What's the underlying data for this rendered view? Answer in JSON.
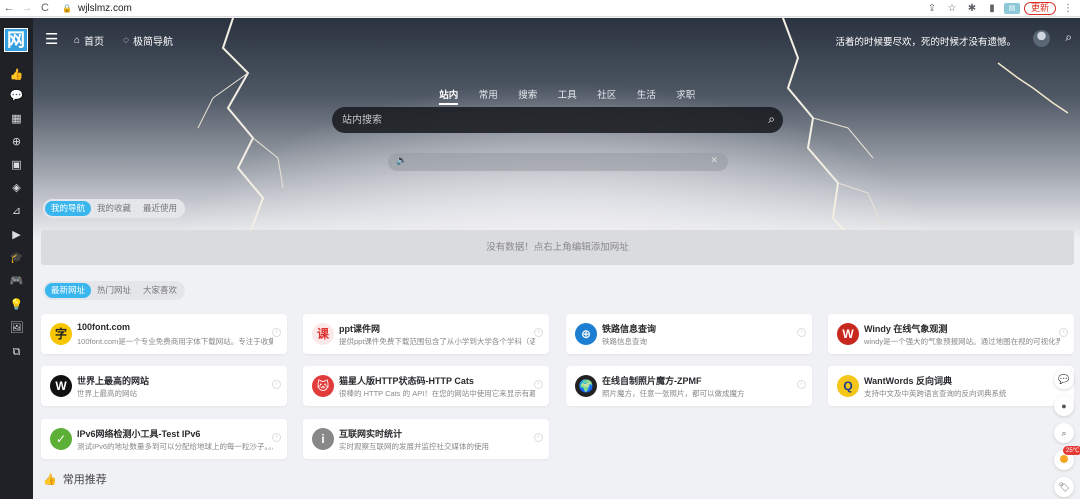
{
  "browser": {
    "url": "wjlslmz.com",
    "update_label": "更新"
  },
  "header": {
    "logo": "网",
    "home_label": "首页",
    "nav_label": "极简导航",
    "motto": "活着的时候要尽欢，死的时候才没有遗憾。"
  },
  "search": {
    "tabs": [
      "站内",
      "常用",
      "搜索",
      "工具",
      "社区",
      "生活",
      "求职"
    ],
    "active_tab": "站内",
    "placeholder": "站内搜索"
  },
  "my_nav": {
    "tabs": [
      "我的导航",
      "我的收藏",
      "最近使用"
    ],
    "empty_text": "没有数据！点右上角编辑添加网址"
  },
  "site_list": {
    "tabs": [
      "最新网址",
      "热门网址",
      "大家喜欢"
    ],
    "cards": [
      {
        "title": "100font.com",
        "desc": "100font.com是一个专业免费商用字体下载网站。专注于收集整...",
        "icon": "字",
        "icon_bg": "#f7c600",
        "icon_color": "#222"
      },
      {
        "title": "ppt课件网",
        "desc": "提供ppt课件免费下载范围包含了从小学到大学各个学科（语文...",
        "icon": "课",
        "icon_bg": "#fbe9e9",
        "icon_color": "#d33"
      },
      {
        "title": "铁路信息查询",
        "desc": "铁路信息查询",
        "icon": "⊕",
        "icon_bg": "#1d7fd1",
        "icon_color": "#fff"
      },
      {
        "title": "Windy 在线气象观测",
        "desc": "windy是一个强大的气象预报网站。通过地图在视的可视化界面...",
        "icon": "W",
        "icon_bg": "#c8281e",
        "icon_color": "#fff"
      },
      {
        "title": "世界上最高的网站",
        "desc": "世界上最高的网站",
        "icon": "W",
        "icon_bg": "#111",
        "icon_color": "#fff"
      },
      {
        "title": "猫星人版HTTP状态码-HTTP Cats",
        "desc": "很棒的 HTTP Cats 的 API！在您的网站中使用它来显示有趣的错...",
        "icon": "🐱",
        "icon_bg": "#e23b3b",
        "icon_color": "#fff"
      },
      {
        "title": "在线自制照片魔方-ZPMF",
        "desc": "照片魔方，任意一张照片，都可以做成魔方",
        "icon": "🌍",
        "icon_bg": "#222",
        "icon_color": "#fff"
      },
      {
        "title": "WantWords 反向词典",
        "desc": "支持中文及中英跨语言查询的反向词典系统",
        "icon": "Q",
        "icon_bg": "#f5c518",
        "icon_color": "#1a3b8c"
      },
      {
        "title": "IPv6网络检测小工具-Test IPv6",
        "desc": "测试IPv6的地址数量多到可以分配给地球上的每一粒沙子。。。...",
        "icon": "✓",
        "icon_bg": "#5cb038",
        "icon_color": "#fff"
      },
      {
        "title": "互联网实时统计",
        "desc": "实时观察互联网的发展并监控社交媒体的使用",
        "icon": "i",
        "icon_bg": "#888",
        "icon_color": "#fff"
      }
    ]
  },
  "section": {
    "common_title": "常用推荐"
  },
  "float": {
    "weather": "25℃"
  }
}
